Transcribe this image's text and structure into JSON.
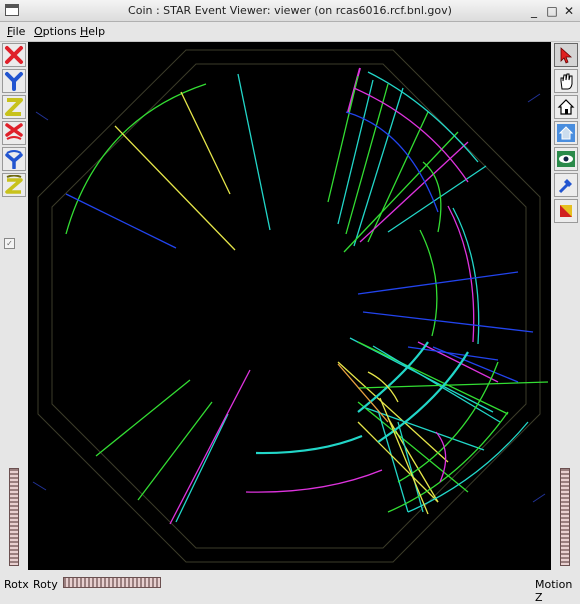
{
  "window": {
    "title": "Coin : STAR Event Viewer: viewer (on rcas6016.rcf.bnl.gov)",
    "minimize_glyph": "_",
    "maximize_glyph": "□",
    "close_glyph": "✕"
  },
  "menubar": {
    "items": [
      {
        "label": "File",
        "underline": "F",
        "rest": "ile"
      },
      {
        "label": "Options",
        "underline": "O",
        "rest": "ptions"
      },
      {
        "label": "Help",
        "underline": "H",
        "rest": "elp"
      }
    ]
  },
  "left_toolbar": {
    "buttons": [
      {
        "icon": "x-axis-view-icon",
        "glyph": "X",
        "color": "#e0202a"
      },
      {
        "icon": "y-axis-view-icon",
        "glyph": "Y",
        "color": "#2255d0"
      },
      {
        "icon": "z-axis-view-icon",
        "glyph": "Z",
        "color": "#c8c21c"
      },
      {
        "icon": "x-axis-reverse-icon",
        "glyph": "X",
        "color": "#e0202a"
      },
      {
        "icon": "y-axis-reverse-icon",
        "glyph": "Y",
        "color": "#2255d0"
      },
      {
        "icon": "z-axis-reverse-icon",
        "glyph": "Z",
        "color": "#c8c21c"
      }
    ],
    "checkbox_checked": true
  },
  "right_toolbar": {
    "buttons": [
      {
        "icon": "select-arrow-icon"
      },
      {
        "icon": "hand-view-icon"
      },
      {
        "icon": "home-icon"
      },
      {
        "icon": "set-home-icon"
      },
      {
        "icon": "view-all-icon"
      },
      {
        "icon": "seek-icon"
      },
      {
        "icon": "projection-icon"
      }
    ]
  },
  "statusbar": {
    "rotx_label": "Rotx",
    "roty_label": "Roty",
    "motion_label": "Motion Z"
  },
  "colors": {
    "viewer_bg": "#000000",
    "track_green": "#33dd33",
    "track_yellow": "#e6e64a",
    "track_cyan": "#22d6c8",
    "track_blue": "#2244ee",
    "track_magenta": "#dd33dd",
    "detector_outline": "#3c3c2a"
  }
}
